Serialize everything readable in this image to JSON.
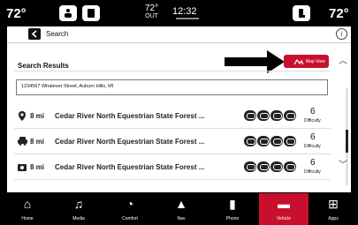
{
  "status_bar": {
    "driver_temp": "72°",
    "passenger_temp": "72°",
    "outside_temp": "72°",
    "outside_label": "OUT",
    "time": "12:32"
  },
  "header": {
    "title": "Search",
    "info_glyph": "i"
  },
  "results": {
    "label": "Search Results",
    "map_view_label": "Map View",
    "address": "1234567 Whatever Street, Auburn Hills, MI",
    "rows": [
      {
        "icon": "pin-icon",
        "distance": "8 mi",
        "name": "Cedar River North Equestrian State Forest ...",
        "difficulty": "6",
        "difficulty_label": "Difficulty"
      },
      {
        "icon": "vehicle-icon",
        "distance": "8 mi",
        "name": "Cedar River North Equestrian State Forest ...",
        "difficulty": "6",
        "difficulty_label": "Difficulty"
      },
      {
        "icon": "camera-icon",
        "distance": "8 mi",
        "name": "Cedar River North Equestrian State Forest ...",
        "difficulty": "6",
        "difficulty_label": "Difficulty"
      }
    ]
  },
  "nav": {
    "items": [
      {
        "label": "Home",
        "glyph": "⌂"
      },
      {
        "label": "Media",
        "glyph": "♫"
      },
      {
        "label": "Comfort",
        "glyph": "◔"
      },
      {
        "label": "Nav",
        "glyph": "▲"
      },
      {
        "label": "Phone",
        "glyph": "▮"
      },
      {
        "label": "Vehicle",
        "glyph": "▬"
      },
      {
        "label": "Apps",
        "glyph": "⊞"
      }
    ],
    "active": "Vehicle"
  },
  "colors": {
    "accent": "#c8102e",
    "background": "#000000",
    "panel": "#ffffff"
  }
}
